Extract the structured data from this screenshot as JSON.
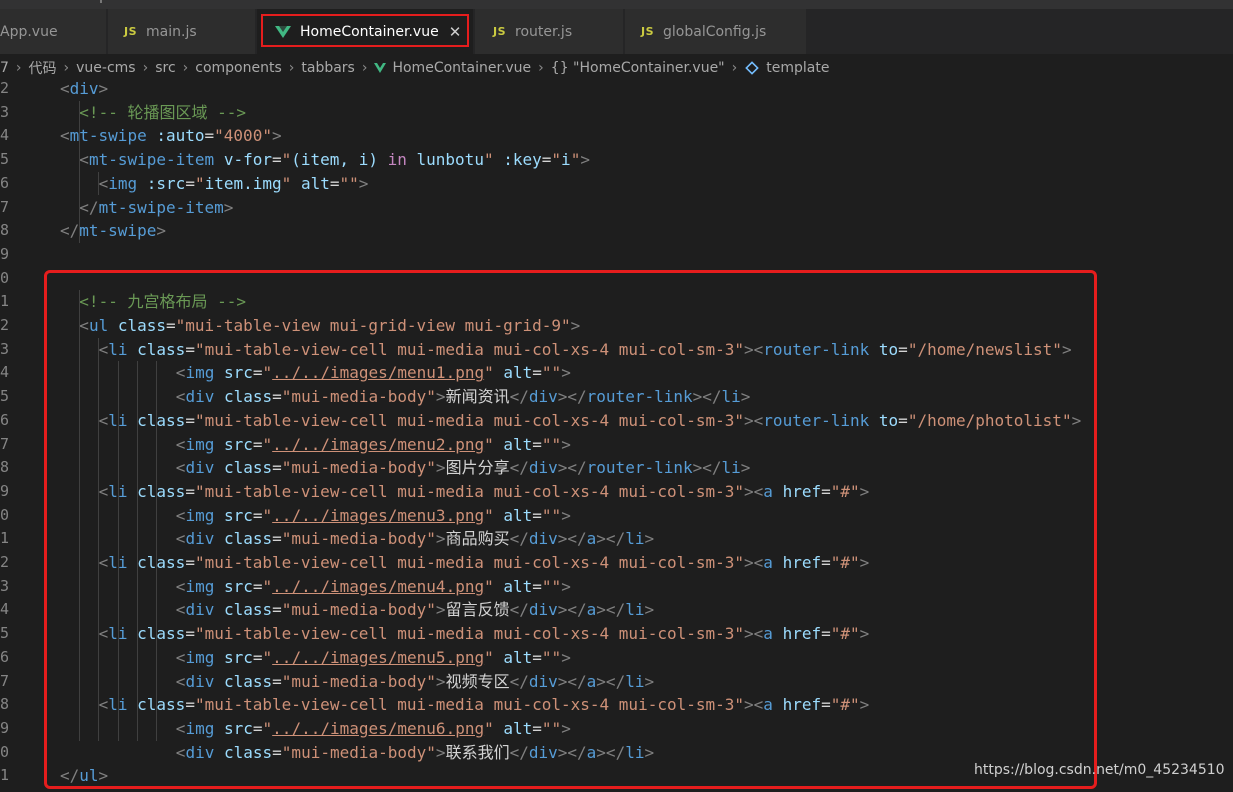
{
  "tabs": [
    {
      "label": "App.vue",
      "kind": "vue"
    },
    {
      "label": "main.js",
      "kind": "js"
    },
    {
      "label": "HomeContainer.vue",
      "kind": "vue",
      "active": true
    },
    {
      "label": "router.js",
      "kind": "js"
    },
    {
      "label": "globalConfig.js",
      "kind": "js"
    }
  ],
  "js_icon": "JS",
  "close_icon": "✕",
  "breadcrumb": {
    "items": [
      "7",
      "代码",
      "vue-cms",
      "src",
      "components",
      "tabbars",
      "HomeContainer.vue",
      "{} \"HomeContainer.vue\"",
      "template"
    ],
    "separator": "›"
  },
  "lines": [
    {
      "num": "2",
      "indent": 0,
      "tokens": [
        [
          "p",
          "<"
        ],
        [
          "t",
          "div"
        ],
        [
          "p",
          ">"
        ]
      ]
    },
    {
      "num": "3",
      "indent": 1,
      "tokens": [
        [
          "c",
          "<!-- 轮播图区域 -->"
        ]
      ]
    },
    {
      "num": "4",
      "indent": 0,
      "tokens": [
        [
          "p",
          "<"
        ],
        [
          "t",
          "mt-swipe"
        ],
        [
          "x",
          " "
        ],
        [
          "a",
          ":auto"
        ],
        [
          "x",
          "="
        ],
        [
          "s",
          "\"4000\""
        ],
        [
          "p",
          ">"
        ]
      ]
    },
    {
      "num": "5",
      "indent": 1,
      "tokens": [
        [
          "p",
          "<"
        ],
        [
          "t",
          "mt-swipe-item"
        ],
        [
          "x",
          " "
        ],
        [
          "a",
          "v-for"
        ],
        [
          "x",
          "="
        ],
        [
          "s",
          "\""
        ],
        [
          "v",
          "(item, i)"
        ],
        [
          "x",
          " "
        ],
        [
          "k",
          "in"
        ],
        [
          "x",
          " "
        ],
        [
          "v",
          "lunbotu"
        ],
        [
          "s",
          "\""
        ],
        [
          "x",
          " "
        ],
        [
          "a",
          ":key"
        ],
        [
          "x",
          "="
        ],
        [
          "s",
          "\""
        ],
        [
          "v",
          "i"
        ],
        [
          "s",
          "\""
        ],
        [
          "p",
          ">"
        ]
      ]
    },
    {
      "num": "6",
      "indent": 2,
      "tokens": [
        [
          "p",
          "<"
        ],
        [
          "t",
          "img"
        ],
        [
          "x",
          " "
        ],
        [
          "a",
          ":src"
        ],
        [
          "x",
          "="
        ],
        [
          "s",
          "\""
        ],
        [
          "v",
          "item.img"
        ],
        [
          "s",
          "\""
        ],
        [
          "x",
          " "
        ],
        [
          "a",
          "alt"
        ],
        [
          "x",
          "="
        ],
        [
          "s",
          "\"\""
        ],
        [
          "p",
          ">"
        ]
      ]
    },
    {
      "num": "7",
      "indent": 1,
      "tokens": [
        [
          "p",
          "</"
        ],
        [
          "t",
          "mt-swipe-item"
        ],
        [
          "p",
          ">"
        ]
      ]
    },
    {
      "num": "8",
      "indent": 0,
      "tokens": [
        [
          "p",
          "</"
        ],
        [
          "t",
          "mt-swipe"
        ],
        [
          "p",
          ">"
        ]
      ]
    },
    {
      "num": "9",
      "indent": 0,
      "tokens": []
    },
    {
      "num": "0",
      "indent": 0,
      "tokens": []
    },
    {
      "num": "1",
      "indent": 1,
      "tokens": [
        [
          "c",
          "<!-- 九宫格布局 -->"
        ]
      ]
    },
    {
      "num": "2",
      "indent": 1,
      "tokens": [
        [
          "p",
          "<"
        ],
        [
          "t",
          "ul"
        ],
        [
          "x",
          " "
        ],
        [
          "a",
          "class"
        ],
        [
          "x",
          "="
        ],
        [
          "s",
          "\"mui-table-view mui-grid-view mui-grid-9\""
        ],
        [
          "p",
          ">"
        ]
      ]
    },
    {
      "num": "3",
      "indent": 2,
      "tokens": [
        [
          "p",
          "<"
        ],
        [
          "t",
          "li"
        ],
        [
          "x",
          " "
        ],
        [
          "a",
          "class"
        ],
        [
          "x",
          "="
        ],
        [
          "s",
          "\"mui-table-view-cell mui-media mui-col-xs-4 mui-col-sm-3\""
        ],
        [
          "p",
          "><"
        ],
        [
          "t",
          "router-link"
        ],
        [
          "x",
          " "
        ],
        [
          "a",
          "to"
        ],
        [
          "x",
          "="
        ],
        [
          "s",
          "\"/home/newslist\""
        ],
        [
          "p",
          ">"
        ]
      ]
    },
    {
      "num": "4",
      "indent": 6,
      "tokens": [
        [
          "p",
          "<"
        ],
        [
          "t",
          "img"
        ],
        [
          "x",
          " "
        ],
        [
          "a",
          "src"
        ],
        [
          "x",
          "="
        ],
        [
          "s",
          "\""
        ],
        [
          "su",
          "../../images/menu1.png"
        ],
        [
          "s",
          "\""
        ],
        [
          "x",
          " "
        ],
        [
          "a",
          "alt"
        ],
        [
          "x",
          "="
        ],
        [
          "s",
          "\"\""
        ],
        [
          "p",
          ">"
        ]
      ]
    },
    {
      "num": "5",
      "indent": 6,
      "tokens": [
        [
          "p",
          "<"
        ],
        [
          "t",
          "div"
        ],
        [
          "x",
          " "
        ],
        [
          "a",
          "class"
        ],
        [
          "x",
          "="
        ],
        [
          "s",
          "\"mui-media-body\""
        ],
        [
          "p",
          ">"
        ],
        [
          "x",
          "新闻资讯"
        ],
        [
          "p",
          "</"
        ],
        [
          "t",
          "div"
        ],
        [
          "p",
          "></"
        ],
        [
          "t",
          "router-link"
        ],
        [
          "p",
          "></"
        ],
        [
          "t",
          "li"
        ],
        [
          "p",
          ">"
        ]
      ]
    },
    {
      "num": "6",
      "indent": 2,
      "tokens": [
        [
          "p",
          "<"
        ],
        [
          "t",
          "li"
        ],
        [
          "x",
          " "
        ],
        [
          "a",
          "class"
        ],
        [
          "x",
          "="
        ],
        [
          "s",
          "\"mui-table-view-cell mui-media mui-col-xs-4 mui-col-sm-3\""
        ],
        [
          "p",
          "><"
        ],
        [
          "t",
          "router-link"
        ],
        [
          "x",
          " "
        ],
        [
          "a",
          "to"
        ],
        [
          "x",
          "="
        ],
        [
          "s",
          "\"/home/photolist\""
        ],
        [
          "p",
          ">"
        ]
      ]
    },
    {
      "num": "7",
      "indent": 6,
      "tokens": [
        [
          "p",
          "<"
        ],
        [
          "t",
          "img"
        ],
        [
          "x",
          " "
        ],
        [
          "a",
          "src"
        ],
        [
          "x",
          "="
        ],
        [
          "s",
          "\""
        ],
        [
          "su",
          "../../images/menu2.png"
        ],
        [
          "s",
          "\""
        ],
        [
          "x",
          " "
        ],
        [
          "a",
          "alt"
        ],
        [
          "x",
          "="
        ],
        [
          "s",
          "\"\""
        ],
        [
          "p",
          ">"
        ]
      ]
    },
    {
      "num": "8",
      "indent": 6,
      "tokens": [
        [
          "p",
          "<"
        ],
        [
          "t",
          "div"
        ],
        [
          "x",
          " "
        ],
        [
          "a",
          "class"
        ],
        [
          "x",
          "="
        ],
        [
          "s",
          "\"mui-media-body\""
        ],
        [
          "p",
          ">"
        ],
        [
          "x",
          "图片分享"
        ],
        [
          "p",
          "</"
        ],
        [
          "t",
          "div"
        ],
        [
          "p",
          "></"
        ],
        [
          "t",
          "router-link"
        ],
        [
          "p",
          "></"
        ],
        [
          "t",
          "li"
        ],
        [
          "p",
          ">"
        ]
      ]
    },
    {
      "num": "9",
      "indent": 2,
      "tokens": [
        [
          "p",
          "<"
        ],
        [
          "t",
          "li"
        ],
        [
          "x",
          " "
        ],
        [
          "a",
          "class"
        ],
        [
          "x",
          "="
        ],
        [
          "s",
          "\"mui-table-view-cell mui-media mui-col-xs-4 mui-col-sm-3\""
        ],
        [
          "p",
          "><"
        ],
        [
          "t",
          "a"
        ],
        [
          "x",
          " "
        ],
        [
          "a",
          "href"
        ],
        [
          "x",
          "="
        ],
        [
          "s",
          "\"#\""
        ],
        [
          "p",
          ">"
        ]
      ]
    },
    {
      "num": "0",
      "indent": 6,
      "tokens": [
        [
          "p",
          "<"
        ],
        [
          "t",
          "img"
        ],
        [
          "x",
          " "
        ],
        [
          "a",
          "src"
        ],
        [
          "x",
          "="
        ],
        [
          "s",
          "\""
        ],
        [
          "su",
          "../../images/menu3.png"
        ],
        [
          "s",
          "\""
        ],
        [
          "x",
          " "
        ],
        [
          "a",
          "alt"
        ],
        [
          "x",
          "="
        ],
        [
          "s",
          "\"\""
        ],
        [
          "p",
          ">"
        ]
      ]
    },
    {
      "num": "1",
      "indent": 6,
      "tokens": [
        [
          "p",
          "<"
        ],
        [
          "t",
          "div"
        ],
        [
          "x",
          " "
        ],
        [
          "a",
          "class"
        ],
        [
          "x",
          "="
        ],
        [
          "s",
          "\"mui-media-body\""
        ],
        [
          "p",
          ">"
        ],
        [
          "x",
          "商品购买"
        ],
        [
          "p",
          "</"
        ],
        [
          "t",
          "div"
        ],
        [
          "p",
          "></"
        ],
        [
          "t",
          "a"
        ],
        [
          "p",
          "></"
        ],
        [
          "t",
          "li"
        ],
        [
          "p",
          ">"
        ]
      ]
    },
    {
      "num": "2",
      "indent": 2,
      "tokens": [
        [
          "p",
          "<"
        ],
        [
          "t",
          "li"
        ],
        [
          "x",
          " "
        ],
        [
          "a",
          "class"
        ],
        [
          "x",
          "="
        ],
        [
          "s",
          "\"mui-table-view-cell mui-media mui-col-xs-4 mui-col-sm-3\""
        ],
        [
          "p",
          "><"
        ],
        [
          "t",
          "a"
        ],
        [
          "x",
          " "
        ],
        [
          "a",
          "href"
        ],
        [
          "x",
          "="
        ],
        [
          "s",
          "\"#\""
        ],
        [
          "p",
          ">"
        ]
      ]
    },
    {
      "num": "3",
      "indent": 6,
      "tokens": [
        [
          "p",
          "<"
        ],
        [
          "t",
          "img"
        ],
        [
          "x",
          " "
        ],
        [
          "a",
          "src"
        ],
        [
          "x",
          "="
        ],
        [
          "s",
          "\""
        ],
        [
          "su",
          "../../images/menu4.png"
        ],
        [
          "s",
          "\""
        ],
        [
          "x",
          " "
        ],
        [
          "a",
          "alt"
        ],
        [
          "x",
          "="
        ],
        [
          "s",
          "\"\""
        ],
        [
          "p",
          ">"
        ]
      ]
    },
    {
      "num": "4",
      "indent": 6,
      "tokens": [
        [
          "p",
          "<"
        ],
        [
          "t",
          "div"
        ],
        [
          "x",
          " "
        ],
        [
          "a",
          "class"
        ],
        [
          "x",
          "="
        ],
        [
          "s",
          "\"mui-media-body\""
        ],
        [
          "p",
          ">"
        ],
        [
          "x",
          "留言反馈"
        ],
        [
          "p",
          "</"
        ],
        [
          "t",
          "div"
        ],
        [
          "p",
          "></"
        ],
        [
          "t",
          "a"
        ],
        [
          "p",
          "></"
        ],
        [
          "t",
          "li"
        ],
        [
          "p",
          ">"
        ]
      ]
    },
    {
      "num": "5",
      "indent": 2,
      "tokens": [
        [
          "p",
          "<"
        ],
        [
          "t",
          "li"
        ],
        [
          "x",
          " "
        ],
        [
          "a",
          "class"
        ],
        [
          "x",
          "="
        ],
        [
          "s",
          "\"mui-table-view-cell mui-media mui-col-xs-4 mui-col-sm-3\""
        ],
        [
          "p",
          "><"
        ],
        [
          "t",
          "a"
        ],
        [
          "x",
          " "
        ],
        [
          "a",
          "href"
        ],
        [
          "x",
          "="
        ],
        [
          "s",
          "\"#\""
        ],
        [
          "p",
          ">"
        ]
      ]
    },
    {
      "num": "6",
      "indent": 6,
      "tokens": [
        [
          "p",
          "<"
        ],
        [
          "t",
          "img"
        ],
        [
          "x",
          " "
        ],
        [
          "a",
          "src"
        ],
        [
          "x",
          "="
        ],
        [
          "s",
          "\""
        ],
        [
          "su",
          "../../images/menu5.png"
        ],
        [
          "s",
          "\""
        ],
        [
          "x",
          " "
        ],
        [
          "a",
          "alt"
        ],
        [
          "x",
          "="
        ],
        [
          "s",
          "\"\""
        ],
        [
          "p",
          ">"
        ]
      ]
    },
    {
      "num": "7",
      "indent": 6,
      "tokens": [
        [
          "p",
          "<"
        ],
        [
          "t",
          "div"
        ],
        [
          "x",
          " "
        ],
        [
          "a",
          "class"
        ],
        [
          "x",
          "="
        ],
        [
          "s",
          "\"mui-media-body\""
        ],
        [
          "p",
          ">"
        ],
        [
          "x",
          "视频专区"
        ],
        [
          "p",
          "</"
        ],
        [
          "t",
          "div"
        ],
        [
          "p",
          "></"
        ],
        [
          "t",
          "a"
        ],
        [
          "p",
          "></"
        ],
        [
          "t",
          "li"
        ],
        [
          "p",
          ">"
        ]
      ]
    },
    {
      "num": "8",
      "indent": 2,
      "tokens": [
        [
          "p",
          "<"
        ],
        [
          "t",
          "li"
        ],
        [
          "x",
          " "
        ],
        [
          "a",
          "class"
        ],
        [
          "x",
          "="
        ],
        [
          "s",
          "\"mui-table-view-cell mui-media mui-col-xs-4 mui-col-sm-3\""
        ],
        [
          "p",
          "><"
        ],
        [
          "t",
          "a"
        ],
        [
          "x",
          " "
        ],
        [
          "a",
          "href"
        ],
        [
          "x",
          "="
        ],
        [
          "s",
          "\"#\""
        ],
        [
          "p",
          ">"
        ]
      ]
    },
    {
      "num": "9",
      "indent": 6,
      "tokens": [
        [
          "p",
          "<"
        ],
        [
          "t",
          "img"
        ],
        [
          "x",
          " "
        ],
        [
          "a",
          "src"
        ],
        [
          "x",
          "="
        ],
        [
          "s",
          "\""
        ],
        [
          "su",
          "../../images/menu6.png"
        ],
        [
          "s",
          "\""
        ],
        [
          "x",
          " "
        ],
        [
          "a",
          "alt"
        ],
        [
          "x",
          "="
        ],
        [
          "s",
          "\"\""
        ],
        [
          "p",
          ">"
        ]
      ]
    },
    {
      "num": "0",
      "indent": 6,
      "tokens": [
        [
          "p",
          "<"
        ],
        [
          "t",
          "div"
        ],
        [
          "x",
          " "
        ],
        [
          "a",
          "class"
        ],
        [
          "x",
          "="
        ],
        [
          "s",
          "\"mui-media-body\""
        ],
        [
          "p",
          ">"
        ],
        [
          "x",
          "联系我们"
        ],
        [
          "p",
          "</"
        ],
        [
          "t",
          "div"
        ],
        [
          "p",
          "></"
        ],
        [
          "t",
          "a"
        ],
        [
          "p",
          "></"
        ],
        [
          "t",
          "li"
        ],
        [
          "p",
          ">"
        ]
      ]
    },
    {
      "num": "1",
      "indent": 0,
      "tokens": [
        [
          "p",
          "</"
        ],
        [
          "t",
          "ul"
        ],
        [
          "p",
          ">"
        ]
      ]
    }
  ],
  "watermark": "https://blog.csdn.net/m0_45234510",
  "colors": {
    "highlight_box": "#e51d1d",
    "tag": "#569cd6",
    "attr": "#9cdcfe",
    "string": "#ce9178",
    "comment": "#6a9955",
    "vue_green": "#41b883"
  }
}
